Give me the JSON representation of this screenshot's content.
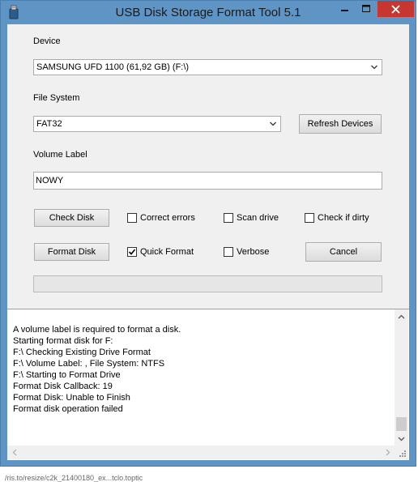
{
  "window": {
    "title": "USB Disk Storage Format Tool 5.1",
    "controls": {
      "minimize": "—",
      "maximize": "☐",
      "close": "✕"
    },
    "colors": {
      "frame": "#5f95c4",
      "close": "#c7372f",
      "client": "#f0f0f0"
    }
  },
  "device": {
    "label": "Device",
    "selected": "SAMSUNG  UFD  1100 (61,92 GB) (F:\\)"
  },
  "file_system": {
    "label": "File System",
    "selected": "FAT32",
    "refresh_label": "Refresh Devices"
  },
  "volume": {
    "label": "Volume Label",
    "value": "NOWY"
  },
  "actions": {
    "check_disk": "Check Disk",
    "format_disk": "Format Disk",
    "cancel": "Cancel"
  },
  "options": {
    "correct_errors": {
      "label": "Correct errors",
      "checked": false
    },
    "scan_drive": {
      "label": "Scan drive",
      "checked": false
    },
    "check_if_dirty": {
      "label": "Check if dirty",
      "checked": false
    },
    "quick_format": {
      "label": "Quick Format",
      "checked": true
    },
    "verbose": {
      "label": "Verbose",
      "checked": false
    }
  },
  "progress": {
    "value": 0
  },
  "log": {
    "lines": [
      "A volume label is required to format a disk.",
      "Starting format disk for F:",
      "F:\\ Checking Existing Drive Format",
      "F:\\ Volume Label: , File System: NTFS",
      "F:\\ Starting to Format Drive",
      "Format Disk Callback: 19",
      "Format Disk: Unable to Finish",
      "Format disk operation failed"
    ]
  },
  "background_text": "/ris.to/resize/c2k_21400180_ex...tclo.toptic"
}
